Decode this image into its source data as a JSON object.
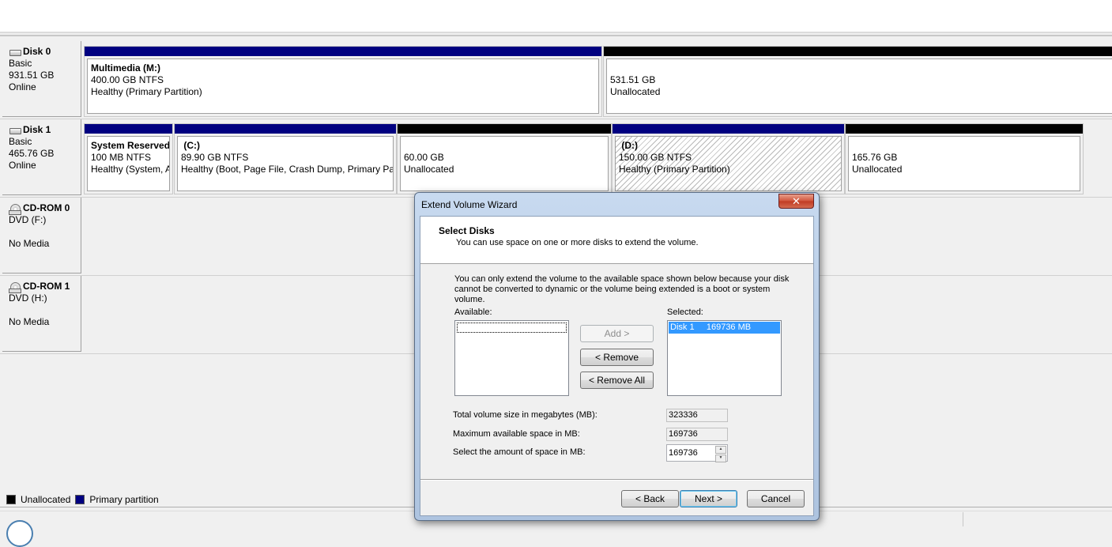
{
  "disks": [
    {
      "name": "Disk 0",
      "type": "Basic",
      "size": "931.51 GB",
      "status": "Online",
      "volumes": [
        {
          "title": "Multimedia  (M:)",
          "line1": "400.00 GB NTFS",
          "line2": "Healthy (Primary Partition)",
          "kind": "primary"
        },
        {
          "title": "",
          "line1": "531.51 GB",
          "line2": "Unallocated",
          "kind": "unallocated"
        }
      ]
    },
    {
      "name": "Disk 1",
      "type": "Basic",
      "size": "465.76 GB",
      "status": "Online",
      "volumes": [
        {
          "title": "System Reserved",
          "line1": "100 MB NTFS",
          "line2": "Healthy (System, Active, Primary Partition)",
          "kind": "primary"
        },
        {
          "title": " (C:)",
          "line1": "89.90 GB NTFS",
          "line2": "Healthy (Boot, Page File, Crash Dump, Primary Partition)",
          "kind": "primary"
        },
        {
          "title": "",
          "line1": "60.00 GB",
          "line2": "Unallocated",
          "kind": "unallocated"
        },
        {
          "title": " (D:)",
          "line1": "150.00 GB NTFS",
          "line2": "Healthy (Primary Partition)",
          "kind": "primary",
          "selected": true
        },
        {
          "title": "",
          "line1": "165.76 GB",
          "line2": "Unallocated",
          "kind": "unallocated"
        }
      ]
    },
    {
      "name": "CD-ROM 0",
      "type": "DVD (F:)",
      "size": "",
      "status": "No Media"
    },
    {
      "name": "CD-ROM 1",
      "type": "DVD (H:)",
      "size": "",
      "status": "No Media"
    }
  ],
  "legend": {
    "unallocated": "Unallocated",
    "primary": "Primary partition",
    "unallocated_color": "#000000",
    "primary_color": "#000080"
  },
  "dialog": {
    "title": "Extend Volume Wizard",
    "close_glyph": "✕",
    "header_title": "Select Disks",
    "header_subtitle": "You can use space on one or more disks to extend the volume.",
    "info": "You can only extend the volume to the available space shown below because your disk cannot be converted to dynamic or the volume being extended is a boot or system volume.",
    "available_label": "Available:",
    "selected_label": "Selected:",
    "selected_items": [
      "Disk 1     169736 MB"
    ],
    "add_button": "Add >",
    "remove_button": "< Remove",
    "remove_all_button": "< Remove All",
    "total_label": "Total volume size in megabytes (MB):",
    "total_value": "323336",
    "max_label": "Maximum available space in MB:",
    "max_value": "169736",
    "amount_label": "Select the amount of space in MB:",
    "amount_value": "169736",
    "back_button": "< Back",
    "next_button": "Next >",
    "cancel_button": "Cancel"
  }
}
